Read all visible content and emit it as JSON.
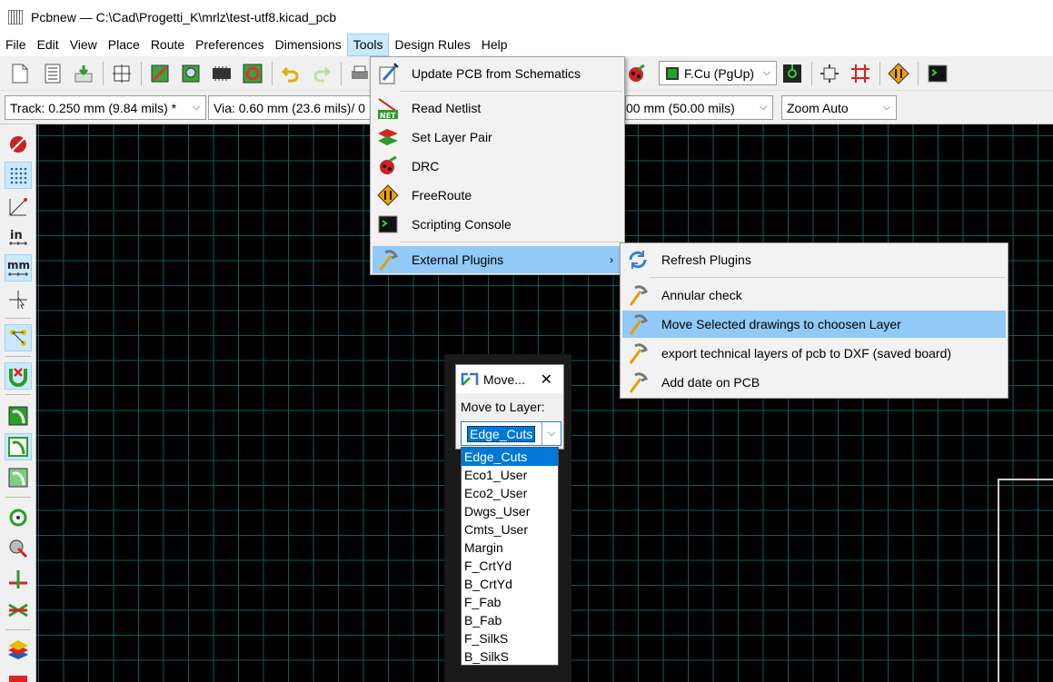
{
  "window": {
    "title": "Pcbnew — C:\\Cad\\Progetti_K\\mrlz\\test-utf8.kicad_pcb"
  },
  "menubar": [
    "File",
    "Edit",
    "View",
    "Place",
    "Route",
    "Preferences",
    "Dimensions",
    "Tools",
    "Design Rules",
    "Help"
  ],
  "toolbar": {
    "layer_select": "F.Cu (PgUp)",
    "layer_color": "#1fa51f"
  },
  "auxbar": {
    "track": "Track: 0.250 mm (9.84 mils) *",
    "via": "Via: 0.60 mm (23.6 mils)/ 0",
    "grid": "00 mm (50.00 mils)",
    "zoom": "Zoom Auto"
  },
  "tools_menu": {
    "items": [
      {
        "label": "Update PCB from Schematics",
        "icon": "update-pcb-icon"
      },
      {
        "label": "Read Netlist",
        "icon": "netlist-icon"
      },
      {
        "label": "Set Layer Pair",
        "icon": "layer-pair-icon"
      },
      {
        "label": "DRC",
        "icon": "drc-icon"
      },
      {
        "label": "FreeRoute",
        "icon": "freeroute-icon"
      },
      {
        "label": "Scripting Console",
        "icon": "scripting-console-icon"
      },
      {
        "label": "External Plugins",
        "icon": "plugins-icon",
        "submenu_arrow": "›"
      }
    ]
  },
  "plugins_menu": {
    "items": [
      {
        "label": "Refresh Plugins",
        "icon": "refresh-icon"
      },
      {
        "label": "Annular check",
        "icon": "hammer-icon"
      },
      {
        "label": "Move Selected drawings to choosen Layer",
        "icon": "hammer-icon"
      },
      {
        "label": "export technical layers of pcb to DXF (saved board)",
        "icon": "hammer-icon"
      },
      {
        "label": "Add date on PCB",
        "icon": "hammer-icon"
      }
    ]
  },
  "dialog": {
    "title": "Move...",
    "close": "✕",
    "label": "Move to Layer:",
    "selected": "Edge_Cuts",
    "options": [
      "Edge_Cuts",
      "Eco1_User",
      "Eco2_User",
      "Dwgs_User",
      "Cmts_User",
      "Margin",
      "F_CrtYd",
      "B_CrtYd",
      "F_Fab",
      "B_Fab",
      "F_SilkS",
      "B_SilkS"
    ]
  },
  "colors": {
    "canvas_bg": "#000000",
    "grid": "#0e5c5c",
    "menu_highlight": "#91c9f7",
    "list_selection": "#0078d7"
  }
}
